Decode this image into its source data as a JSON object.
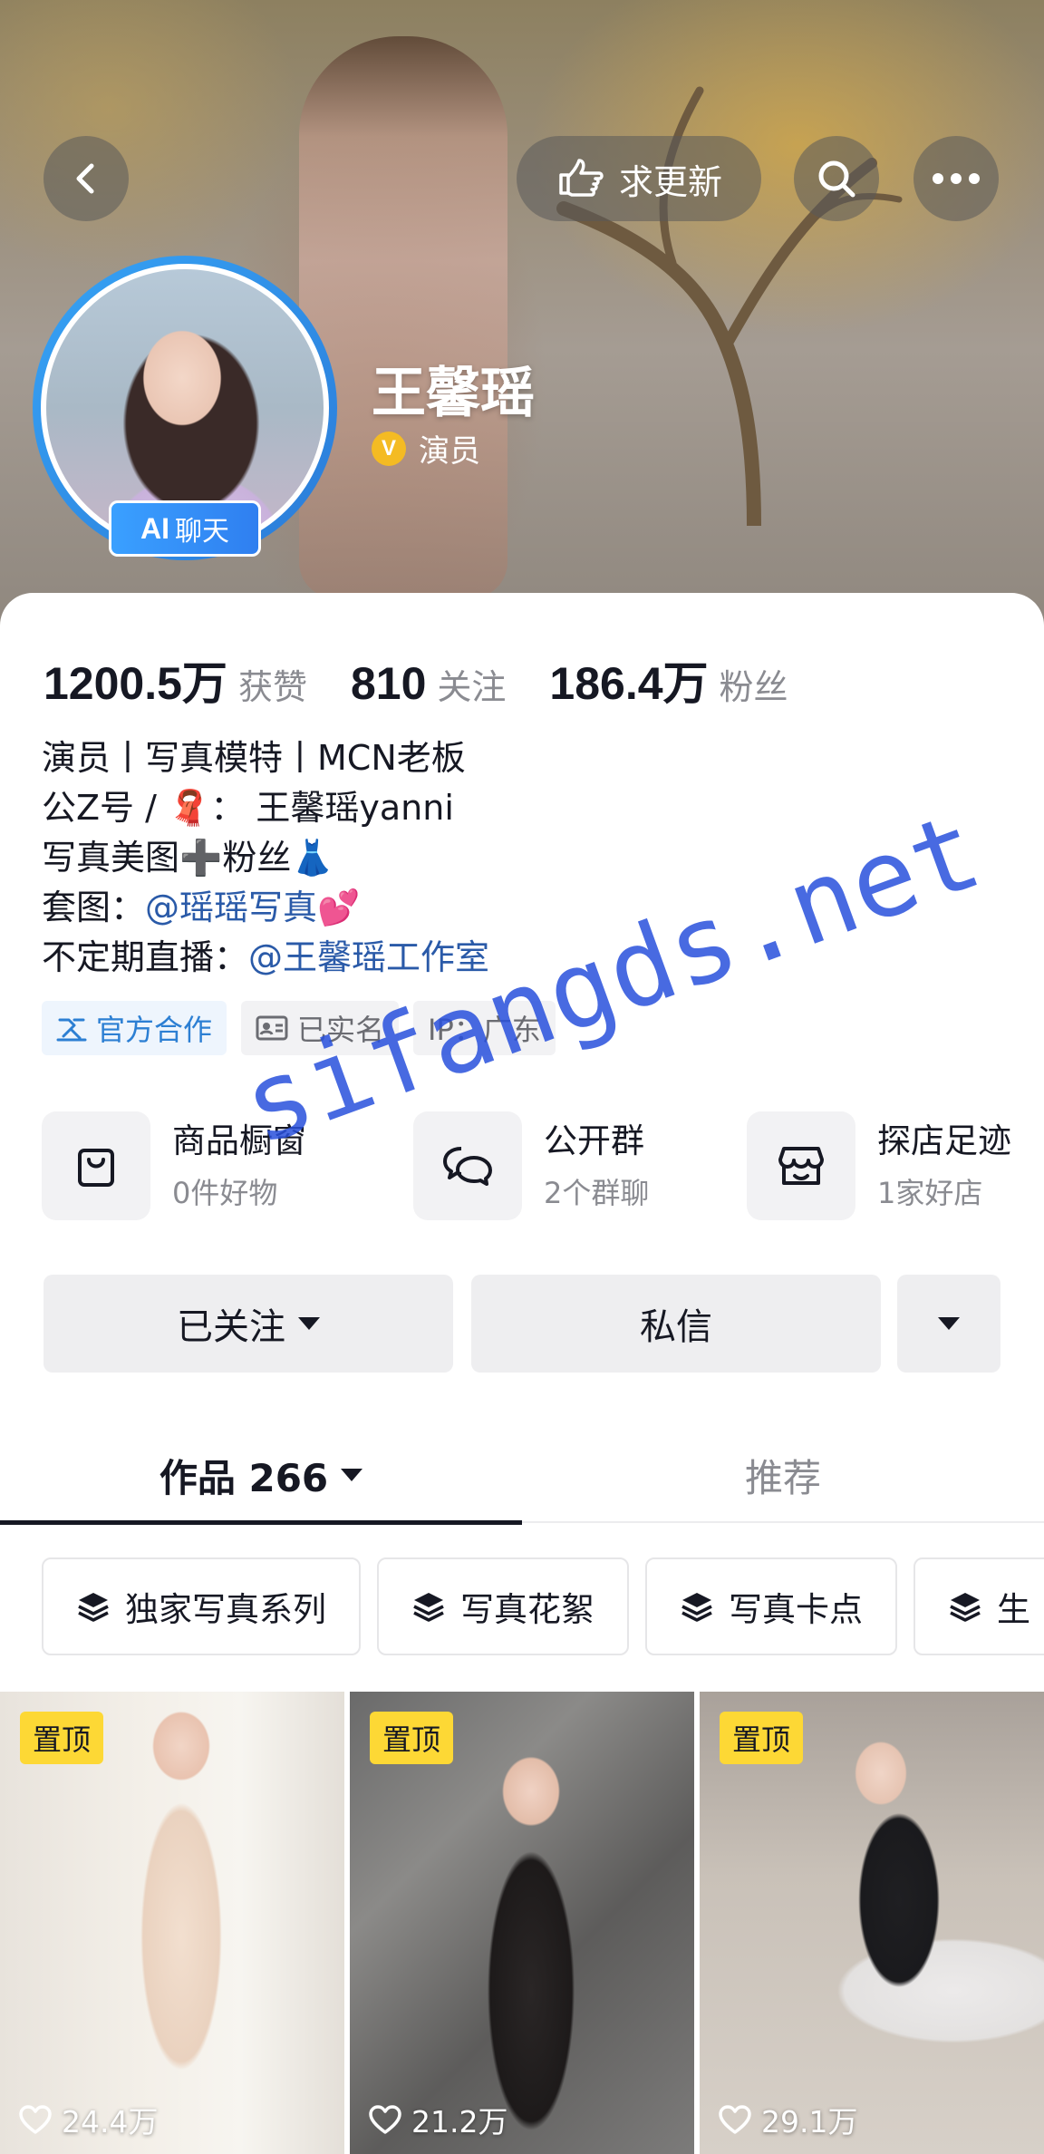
{
  "header": {
    "update_label": "求更新",
    "ai_badge": {
      "ai": "AI",
      "chat": "聊天"
    },
    "name": "王馨瑶",
    "verify_icon": "V",
    "verify_label": "演员"
  },
  "stats": [
    {
      "num": "1200.5万",
      "label": "获赞"
    },
    {
      "num": "810",
      "label": "关注"
    },
    {
      "num": "186.4万",
      "label": "粉丝"
    }
  ],
  "bio": {
    "line1": "演员丨写真模特丨MCN老板",
    "line2_prefix": "公Z号 / ",
    "line2_emoji": "🧣",
    "line2_suffix": "：  王馨瑶yanni",
    "line3_prefix": "写真美图",
    "line3_plus": "➕",
    "line3_text": "粉丝",
    "line3_emoji": "👗",
    "line4_prefix": "套图：",
    "line4_mention": "@瑶瑶写真",
    "line4_emoji": "💕",
    "line5_prefix": "不定期直播：",
    "line5_mention": "@王馨瑶工作室"
  },
  "tags": {
    "official": "官方合作",
    "realname": "已实名",
    "ip": "IP：广东"
  },
  "services": [
    {
      "title": "商品橱窗",
      "sub": "0件好物",
      "icon": "shopping-bag-icon"
    },
    {
      "title": "公开群",
      "sub": "2个群聊",
      "icon": "chat-bubbles-icon"
    },
    {
      "title": "探店足迹",
      "sub": "1家好店",
      "icon": "store-icon"
    }
  ],
  "actions": {
    "followed": "已关注",
    "message": "私信"
  },
  "tabs": {
    "works": "作品 266",
    "recommend": "推荐"
  },
  "collections": [
    "独家写真系列",
    "写真花絮",
    "写真卡点",
    "生"
  ],
  "videos": [
    {
      "pin": "置顶",
      "likes": "24.4万"
    },
    {
      "pin": "置顶",
      "likes": "21.2万"
    },
    {
      "pin": "置顶",
      "likes": "29.1万"
    }
  ],
  "watermark": "sifangds.net",
  "colors": {
    "mention": "#2a5aa8",
    "official_tag": "#2c7fd3",
    "pin_bg": "#fdd835",
    "ai_badge": "#2f7ff0",
    "verify": "#f4bb23"
  }
}
